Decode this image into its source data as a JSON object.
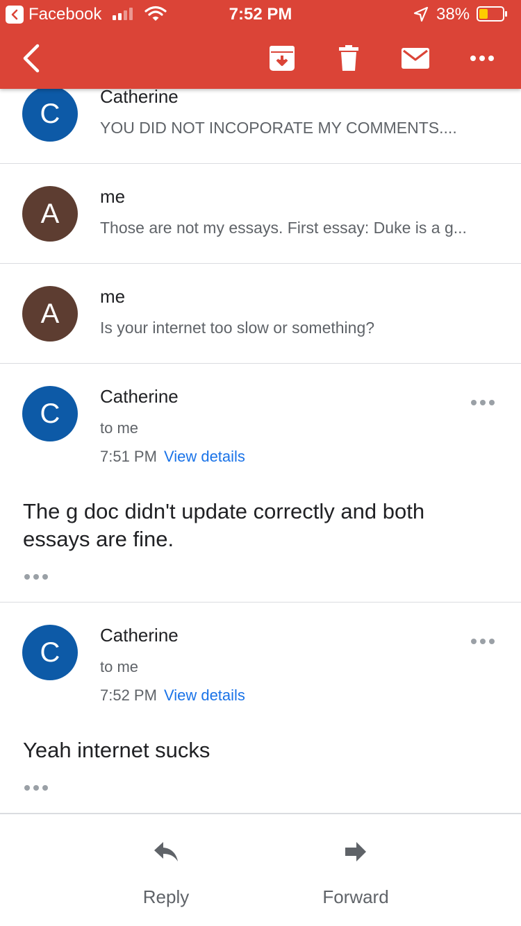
{
  "status_bar": {
    "back_app": "Facebook",
    "time": "7:52 PM",
    "battery_percent": "38%",
    "battery_level": 0.38,
    "signal_bars_active": 2,
    "signal_bars_total": 4
  },
  "toolbar": {
    "icons": [
      "back-arrow-icon",
      "archive-icon",
      "trash-icon",
      "mail-icon",
      "more-icon"
    ]
  },
  "collapsed_messages": [
    {
      "avatar": "C",
      "sender": "Catherine",
      "snippet": "YOU DID NOT INCOPORATE MY COMMENTS...."
    },
    {
      "avatar": "A",
      "sender": "me",
      "snippet": "Those are not my essays. First essay: Duke is a g..."
    },
    {
      "avatar": "A",
      "sender": "me",
      "snippet": "Is your internet too slow or something?"
    }
  ],
  "expanded_messages": [
    {
      "avatar": "C",
      "sender": "Catherine",
      "recipient": "to me",
      "time": "7:51 PM",
      "details_link": "View details",
      "body": "The g doc didn't update correctly and both essays are fine."
    },
    {
      "avatar": "C",
      "sender": "Catherine",
      "recipient": "to me",
      "time": "7:52 PM",
      "details_link": "View details",
      "body": "Yeah internet sucks"
    }
  ],
  "actions": {
    "reply": "Reply",
    "forward": "Forward"
  },
  "colors": {
    "header": "#db4437",
    "avatar_blue": "#0d5aa7",
    "avatar_brown": "#5d3d31",
    "link": "#1a73e8",
    "battery_fill": "#ffcc00"
  }
}
